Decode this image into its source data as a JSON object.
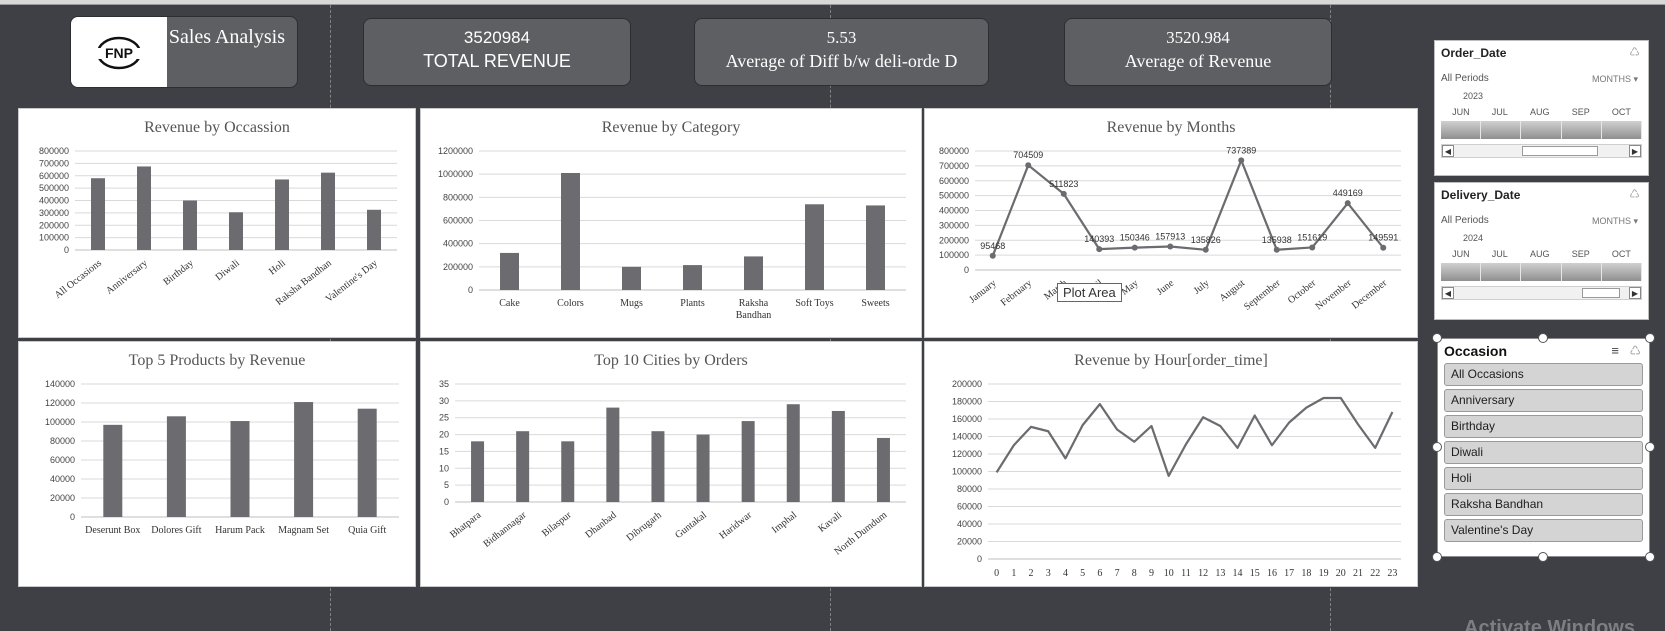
{
  "header": {
    "title": "Sales Analysis",
    "logo_text": "FNP"
  },
  "kpis": [
    {
      "value": "3520984",
      "label": "TOTAL REVENUE"
    },
    {
      "value": "5.53",
      "label": "Average of Diff b/w deli-orde D"
    },
    {
      "value": "3520.984",
      "label": "Average of Revenue"
    }
  ],
  "chart_data": [
    {
      "id": "occasion",
      "type": "bar",
      "title": "Revenue by Occassion",
      "categories": [
        "All Occasions",
        "Anniversary",
        "Birthday",
        "Diwali",
        "Holi",
        "Raksha Bandhan",
        "Valentine's Day"
      ],
      "values": [
        580000,
        675000,
        400000,
        305000,
        570000,
        625000,
        325000
      ],
      "ylim": [
        0,
        800000
      ],
      "yticks": [
        "0",
        "100000",
        "200000",
        "300000",
        "400000",
        "500000",
        "600000",
        "700000",
        "800000"
      ],
      "color": "#6b6b70"
    },
    {
      "id": "category",
      "type": "bar",
      "title": "Revenue by Category",
      "categories": [
        "Cake",
        "Colors",
        "Mugs",
        "Plants",
        "Raksha Bandhan",
        "Soft Toys",
        "Sweets"
      ],
      "values": [
        320000,
        1010000,
        200000,
        215000,
        290000,
        740000,
        730000
      ],
      "ylim": [
        0,
        1200000
      ],
      "yticks": [
        "0",
        "200000",
        "400000",
        "600000",
        "800000",
        "1000000",
        "1200000"
      ],
      "color": "#6b6b70"
    },
    {
      "id": "months",
      "type": "line",
      "title": "Revenue by Months",
      "categories": [
        "January",
        "February",
        "March",
        "April",
        "May",
        "June",
        "July",
        "August",
        "September",
        "October",
        "November",
        "December"
      ],
      "values": [
        95468,
        704509,
        511823,
        140393,
        150346,
        157913,
        135826,
        737389,
        135938,
        151619,
        449169,
        149591
      ],
      "labels": [
        "95468",
        "704509",
        "511823",
        "140393",
        "150346",
        "157913",
        "135826",
        "737389",
        "135938",
        "151619",
        "449169",
        "149591"
      ],
      "ylim": [
        0,
        800000
      ],
      "yticks": [
        "0",
        "100000",
        "200000",
        "300000",
        "400000",
        "500000",
        "600000",
        "700000",
        "800000"
      ],
      "color": "#6b6b70"
    },
    {
      "id": "products",
      "type": "bar",
      "title": "Top 5 Products by Revenue",
      "categories": [
        "Deserunt Box",
        "Dolores Gift",
        "Harum Pack",
        "Magnam Set",
        "Quia Gift"
      ],
      "values": [
        97000,
        106000,
        101000,
        121000,
        114000
      ],
      "ylim": [
        0,
        140000
      ],
      "yticks": [
        "0",
        "20000",
        "40000",
        "60000",
        "80000",
        "100000",
        "120000",
        "140000"
      ],
      "color": "#6b6b70"
    },
    {
      "id": "cities",
      "type": "bar",
      "title": "Top 10 Cities by Orders",
      "categories": [
        "Bhatpara",
        "Bidhannagar",
        "Bilaspur",
        "Dhanbad",
        "Dibrugarh",
        "Guntakal",
        "Haridwar",
        "Imphal",
        "Kavali",
        "North Dumdum"
      ],
      "values": [
        18,
        21,
        18,
        28,
        21,
        20,
        24,
        29,
        27,
        19
      ],
      "ylim": [
        0,
        35
      ],
      "yticks": [
        "0",
        "5",
        "10",
        "15",
        "20",
        "25",
        "30",
        "35"
      ],
      "color": "#6b6b70"
    },
    {
      "id": "hour",
      "type": "line",
      "title": "Revenue by Hour[order_time]",
      "categories": [
        "0",
        "1",
        "2",
        "3",
        "4",
        "5",
        "6",
        "7",
        "8",
        "9",
        "10",
        "11",
        "12",
        "13",
        "14",
        "15",
        "16",
        "17",
        "18",
        "19",
        "20",
        "21",
        "22",
        "23"
      ],
      "values": [
        99000,
        130000,
        151000,
        146000,
        115000,
        153000,
        177000,
        148000,
        134000,
        152000,
        95000,
        131000,
        162000,
        152000,
        127000,
        164000,
        130000,
        156000,
        173000,
        184000,
        184000,
        154000,
        127000,
        168000
      ],
      "ylim": [
        0,
        200000
      ],
      "yticks": [
        "0",
        "20000",
        "40000",
        "60000",
        "80000",
        "100000",
        "120000",
        "140000",
        "160000",
        "180000",
        "200000"
      ],
      "color": "#6b6b70"
    }
  ],
  "slicers": {
    "order_date": {
      "title": "Order_Date",
      "all_periods": "All Periods",
      "level": "MONTHS",
      "year": "2023",
      "months": [
        "JUN",
        "JUL",
        "AUG",
        "SEP",
        "OCT"
      ]
    },
    "delivery_date": {
      "title": "Delivery_Date",
      "all_periods": "All Periods",
      "level": "MONTHS",
      "year": "2024",
      "months": [
        "JUN",
        "JUL",
        "AUG",
        "SEP",
        "OCT"
      ]
    },
    "occasion": {
      "title": "Occasion",
      "items": [
        "All Occasions",
        "Anniversary",
        "Birthday",
        "Diwali",
        "Holi",
        "Raksha Bandhan",
        "Valentine's Day"
      ]
    }
  },
  "tooltip": "Plot Area",
  "watermark": "Activate Windows"
}
